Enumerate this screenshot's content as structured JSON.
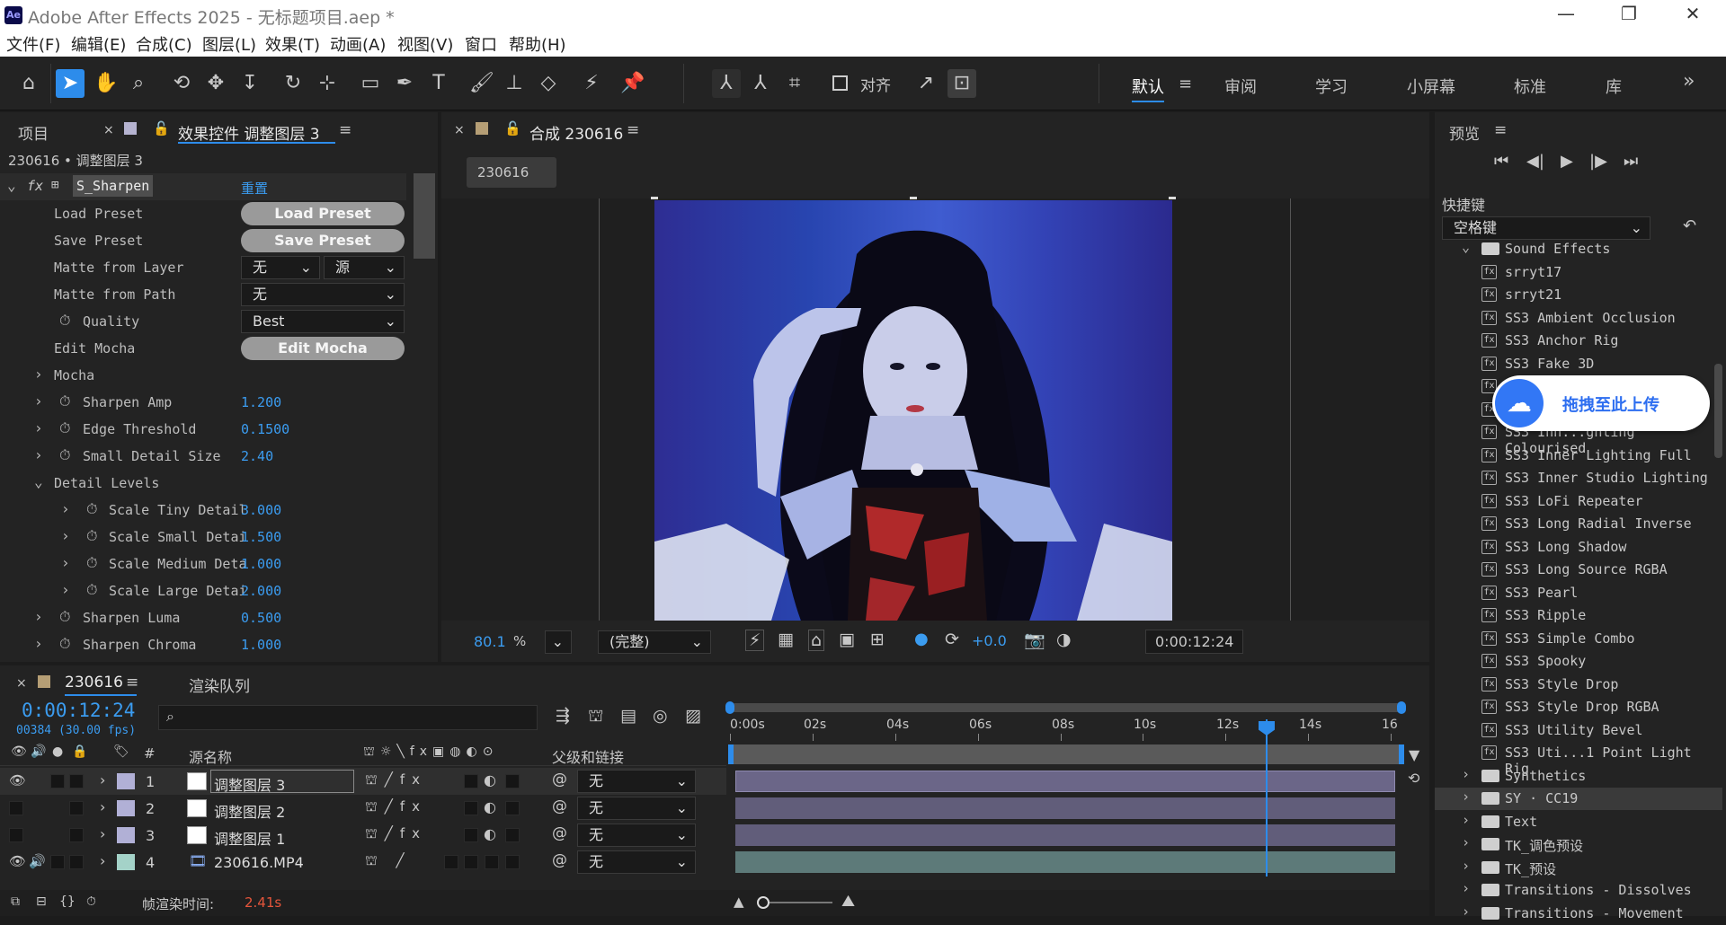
{
  "window": {
    "title": "Adobe After Effects 2025 - 无标题项目.aep *",
    "app_icon": "Ae",
    "min": "—",
    "max": "❐",
    "close": "✕"
  },
  "menu": [
    "文件(F)",
    "编辑(E)",
    "合成(C)",
    "图层(L)",
    "效果(T)",
    "动画(A)",
    "视图(V)",
    "窗口",
    "帮助(H)"
  ],
  "toolbar": {
    "snap_label": "对齐",
    "workspaces": [
      "默认",
      "审阅",
      "学习",
      "小屏幕",
      "标准",
      "库"
    ],
    "more": "»",
    "ws_menu": "≡"
  },
  "project_panel": {
    "tab": "项目",
    "effect_tab": "效果控件 调整图层 3",
    "path": "230616 • 调整图层 3",
    "effect_name": "S_Sharpen",
    "reset": "重置"
  },
  "effect_rows": {
    "load_preset": {
      "label": "Load Preset",
      "button": "Load Preset"
    },
    "save_preset": {
      "label": "Save Preset",
      "button": "Save Preset"
    },
    "matte_layer": {
      "label": "Matte from Layer",
      "v1": "无",
      "v2": "源"
    },
    "matte_path": {
      "label": "Matte from Path",
      "v": "无"
    },
    "quality": {
      "label": "Quality",
      "v": "Best"
    },
    "edit_mocha": {
      "label": "Edit Mocha",
      "button": "Edit Mocha"
    },
    "mocha": {
      "label": "Mocha"
    },
    "sharpen_amp": {
      "label": "Sharpen Amp",
      "v": "1.200"
    },
    "edge": {
      "label": "Edge Threshold",
      "v": "0.1500"
    },
    "small_detail": {
      "label": "Small Detail Size",
      "v": "2.40"
    },
    "detail_levels": {
      "label": "Detail Levels"
    },
    "tiny": {
      "label": "Scale Tiny Detail",
      "v": "3.000"
    },
    "small": {
      "label": "Scale Small Detai",
      "v": "1.500"
    },
    "medium": {
      "label": "Scale Medium Deta",
      "v": "1.000"
    },
    "large": {
      "label": "Scale Large Detai",
      "v": "2.000"
    },
    "luma": {
      "label": "Sharpen Luma",
      "v": "0.500"
    },
    "chroma": {
      "label": "Sharpen Chroma",
      "v": "1.000"
    }
  },
  "comp": {
    "tab": "合成 230616",
    "chip": "230616",
    "zoom": "80.1",
    "zoom_unit": "%",
    "resolution": "(完整)",
    "exposure": "+0.0",
    "timecode": "0:00:12:24"
  },
  "preview": {
    "title": "预览",
    "shortcut_label": "快捷键",
    "shortcut_value": "空格键"
  },
  "effects_list": [
    {
      "type": "folder",
      "name": "Sound Effects"
    },
    {
      "type": "item",
      "name": "srryt17"
    },
    {
      "type": "item",
      "name": "srryt21"
    },
    {
      "type": "item",
      "name": "SS3 Ambient Occlusion"
    },
    {
      "type": "item",
      "name": "SS3 Anchor Rig"
    },
    {
      "type": "item",
      "name": "SS3 Fake 3D"
    },
    {
      "type": "item",
      "name": ""
    },
    {
      "type": "item",
      "name": ""
    },
    {
      "type": "item",
      "name": "SS3 Inn...ghting Colourised"
    },
    {
      "type": "item",
      "name": "SS3 Inner Lighting Full"
    },
    {
      "type": "item",
      "name": "SS3 Inner Studio Lighting"
    },
    {
      "type": "item",
      "name": "SS3 LoFi Repeater"
    },
    {
      "type": "item",
      "name": "SS3 Long Radial Inverse"
    },
    {
      "type": "item",
      "name": "SS3 Long Shadow"
    },
    {
      "type": "item",
      "name": "SS3 Long Source RGBA"
    },
    {
      "type": "item",
      "name": "SS3 Pearl"
    },
    {
      "type": "item",
      "name": "SS3 Ripple"
    },
    {
      "type": "item",
      "name": "SS3 Simple Combo"
    },
    {
      "type": "item",
      "name": "SS3 Spooky"
    },
    {
      "type": "item",
      "name": "SS3 Style Drop"
    },
    {
      "type": "item",
      "name": "SS3 Style Drop RGBA"
    },
    {
      "type": "item",
      "name": "SS3 Utility Bevel"
    },
    {
      "type": "item",
      "name": "SS3 Uti...1 Point Light Rig"
    },
    {
      "type": "folder",
      "name": "Synthetics"
    },
    {
      "type": "folder",
      "name": "SY · CC19"
    },
    {
      "type": "folder",
      "name": "Text"
    },
    {
      "type": "folder",
      "name": "TK_调色预设"
    },
    {
      "type": "folder",
      "name": "TK_预设"
    },
    {
      "type": "folder",
      "name": "Transitions - Dissolves"
    },
    {
      "type": "folder",
      "name": "Transitions - Movement"
    }
  ],
  "upload": {
    "label": "拖拽至此上传"
  },
  "timeline": {
    "tab": "230616",
    "render_tab": "渲染队列",
    "timecode": "0:00:12:24",
    "frames": "00384 (30.00 fps)",
    "col_num": "#",
    "col_name": "源名称",
    "col_parent": "父级和链接",
    "ruler": [
      "0:00s",
      "02s",
      "04s",
      "06s",
      "08s",
      "10s",
      "12s",
      "14s",
      "16"
    ],
    "layers": [
      {
        "num": "1",
        "name": "调整图层 3",
        "parent": "无"
      },
      {
        "num": "2",
        "name": "调整图层 2",
        "parent": "无"
      },
      {
        "num": "3",
        "name": "调整图层 1",
        "parent": "无"
      },
      {
        "num": "4",
        "name": "230616.MP4",
        "parent": "无"
      }
    ],
    "render_time_label": "帧渲染时间:",
    "render_time": "2.41s"
  },
  "colors": {
    "accent": "#2d8ceb",
    "value_blue": "#3b9cf0",
    "layer_adj": "#6b6688",
    "layer_video": "#5d7a79",
    "red": "#e5553b"
  }
}
